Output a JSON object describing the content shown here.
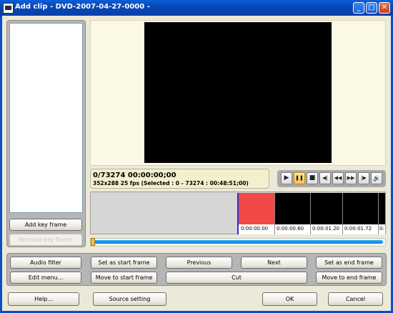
{
  "window": {
    "title": "Add clip - DVD-2007-04-27-0000 -",
    "minimize": "_",
    "maximize": "□",
    "close": "✕"
  },
  "left_panel": {
    "add_key_frame": "Add key frame",
    "remove_key_frame": "Remove key frame"
  },
  "info": {
    "position": "0/73274  00:00:00;00",
    "details": "352x288 25 fps  (Selected : 0 - 73274 : 00:48:51;00)"
  },
  "transport": {
    "play": "▶",
    "pause": "❚❚",
    "stop": "■",
    "prev_frame": "◀|",
    "rewind": "◀◀",
    "fast_forward": "▶▶",
    "next_frame": "|▶",
    "volume": "🔊"
  },
  "timeline": {
    "labels": [
      "0:00:00.00",
      "0:00:00.60",
      "0:00:01.20",
      "0:00:01.72",
      "0:"
    ]
  },
  "actions": {
    "audio_filter": "Audio filter",
    "edit_menu": "Edit menu...",
    "set_start": "Set as start frame",
    "move_start": "Move to start frame",
    "previous": "Previous",
    "next": "Next",
    "cut": "Cut",
    "set_end": "Set as end frame",
    "move_end": "Move to end frame"
  },
  "footer": {
    "help": "Help...",
    "source_setting": "Source setting",
    "ok": "OK",
    "cancel": "Cancel"
  },
  "colors": {
    "titlebar": "#0a4fc6",
    "timeline_selected": "#f24848",
    "slider": "#1a9ae6",
    "info_bg": "#f4efcc"
  },
  "slider_position": 0
}
